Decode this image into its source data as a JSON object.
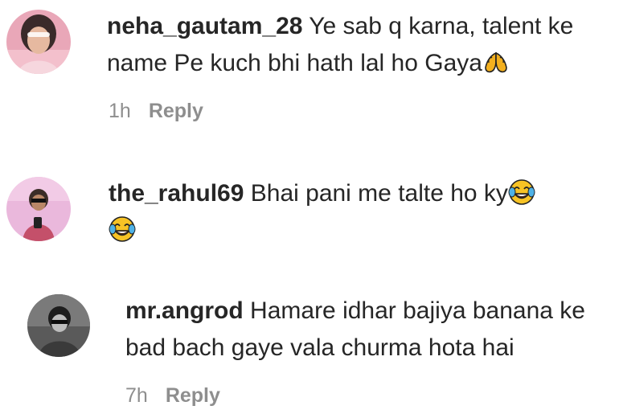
{
  "comments": [
    {
      "username": "neha_gautam_28",
      "text": "Ye sab q karna, talent ke name Pe kuch bhi hath lal ho Gaya",
      "trailing_emoji": "folded-hands-emoji",
      "time": "1h",
      "reply_label": "Reply"
    },
    {
      "username": "the_rahul69",
      "text": "Bhai pani me talte ho ky",
      "trailing_emoji": "face-with-tears-of-joy-emoji",
      "second_line_emoji": "face-with-tears-of-joy-emoji"
    },
    {
      "username": "mr.angrod",
      "text": "Hamare idhar bajiya banana ke bad bach gaye vala churma hota hai",
      "time": "7h",
      "reply_label": "Reply"
    }
  ]
}
